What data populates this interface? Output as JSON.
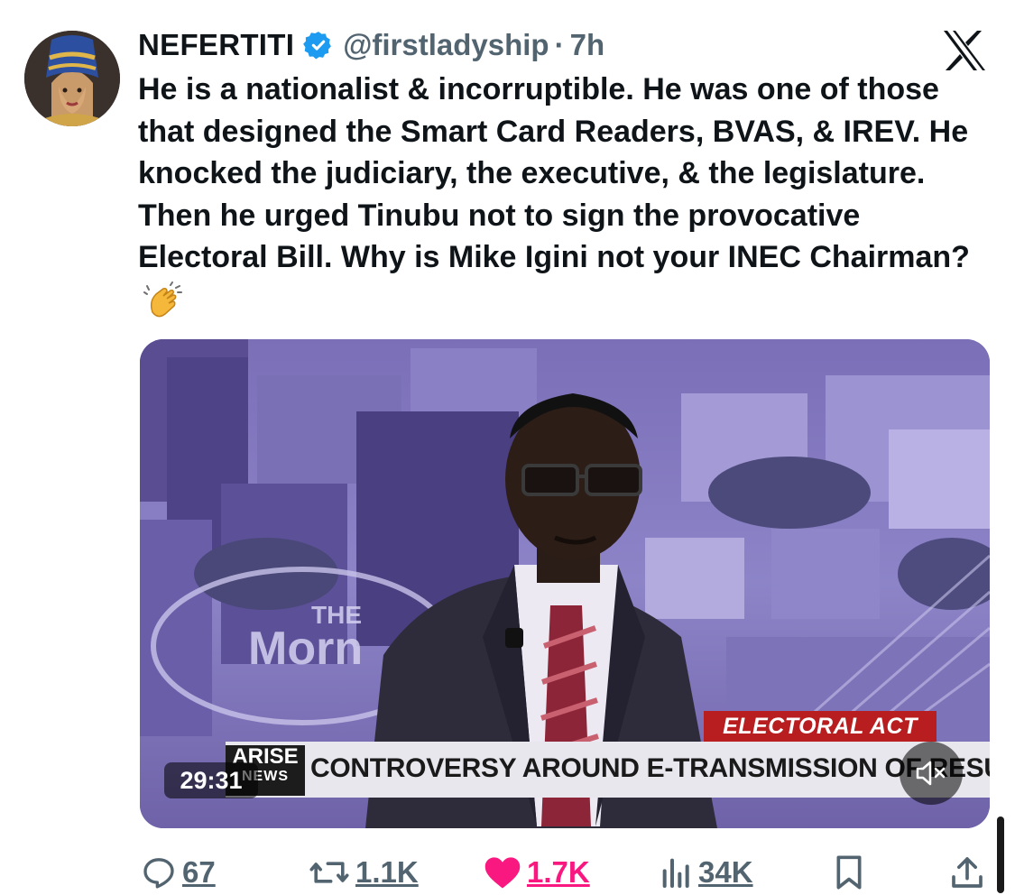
{
  "tweet": {
    "display_name": "NEFERTITI",
    "handle": "@firstladyship",
    "separator": "·",
    "time": "7h",
    "text": "He is a nationalist & incorruptible. He was one of those that designed the Smart Card Readers, BVAS, & IREV. He knocked the judiciary, the executive, & the legislature. Then he urged Tinubu not to sign the provocative Electoral Bill. Why is Mike Igini not your INEC Chairman?",
    "emoji": "clapping-hands"
  },
  "video": {
    "duration": "29:31",
    "lower_third_tag": "ELECTORAL ACT",
    "headline": "CONTROVERSY AROUND E-TRANSMISSION OF RESULTS",
    "channel_logo_top": "ARISE",
    "channel_logo_bottom": "NEWS",
    "background_sign": "THE Morn",
    "muted": true
  },
  "actions": {
    "replies": "67",
    "reposts": "1.1K",
    "likes": "1.7K",
    "views": "34K"
  },
  "colors": {
    "accent_blue": "#1d9bf0",
    "like_pink": "#f91880",
    "secondary_text": "#536471",
    "lower_third_red": "#b81d1f"
  }
}
